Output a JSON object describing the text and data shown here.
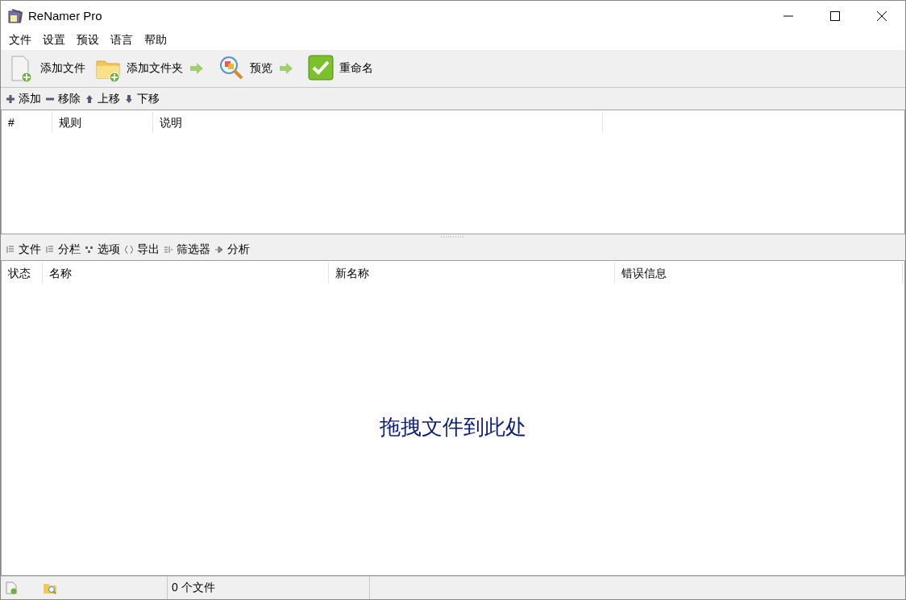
{
  "window": {
    "title": "ReNamer Pro"
  },
  "menu": [
    "文件",
    "设置",
    "预设",
    "语言",
    "帮助"
  ],
  "toolbar": [
    {
      "label": "添加文件",
      "kind": "add-file"
    },
    {
      "label": "添加文件夹",
      "kind": "add-folder"
    },
    {
      "label": "预览",
      "kind": "preview"
    },
    {
      "label": "重命名",
      "kind": "rename"
    }
  ],
  "rules_toolbar": [
    {
      "label": "添加",
      "kind": "add"
    },
    {
      "label": "移除",
      "kind": "remove"
    },
    {
      "label": "上移",
      "kind": "up"
    },
    {
      "label": "下移",
      "kind": "down"
    }
  ],
  "rules_table": {
    "columns": [
      "#",
      "规则",
      "说明"
    ]
  },
  "files_toolbar": [
    {
      "label": "文件",
      "kind": "files"
    },
    {
      "label": "分栏",
      "kind": "columns"
    },
    {
      "label": "选项",
      "kind": "options"
    },
    {
      "label": "导出",
      "kind": "export"
    },
    {
      "label": "筛选器",
      "kind": "filter"
    },
    {
      "label": "分析",
      "kind": "analyze"
    }
  ],
  "files_table": {
    "columns": [
      "状态",
      "名称",
      "新名称",
      "错误信息"
    ],
    "placeholder": "拖拽文件到此处"
  },
  "status_bar": {
    "file_count": "0 个文件"
  }
}
